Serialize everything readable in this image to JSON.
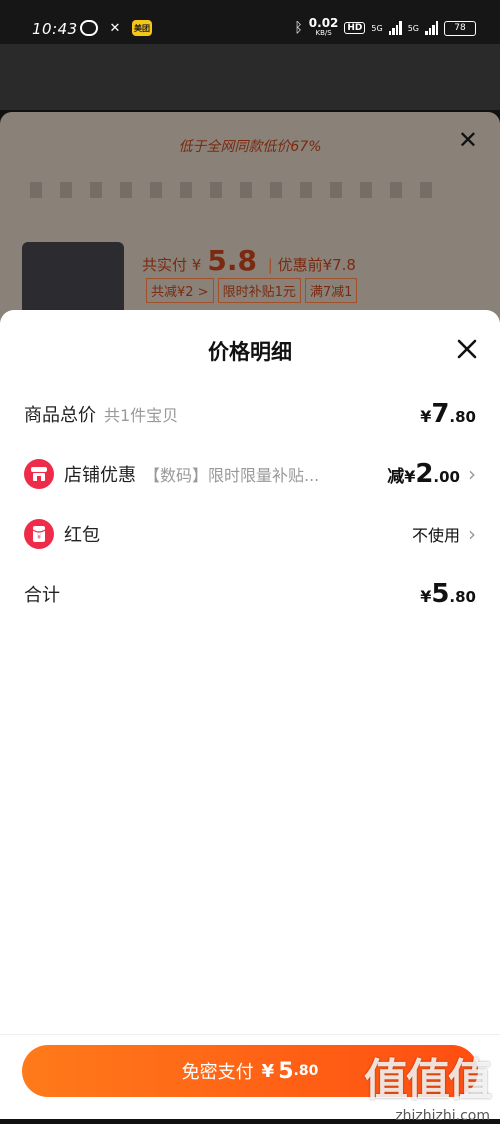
{
  "statusbar": {
    "time": "10:43",
    "speed": "0.02",
    "speed_unit": "KB/S",
    "hd": "HD",
    "net1": "5G",
    "net2": "5G",
    "battery": "78",
    "meituan": "美团"
  },
  "background": {
    "banner": "低于全网同款低价67%",
    "total_label": "共实付",
    "total_yen": "¥",
    "total": "5.8",
    "original": "优惠前¥7.8",
    "tags": [
      "共减¥2 >",
      "限时补贴1元",
      "满7减1"
    ]
  },
  "sheet": {
    "title": "价格明细",
    "rows": {
      "goods_total": {
        "label": "商品总价",
        "sub": "共1件宝贝",
        "yen": "¥",
        "big": "7",
        "cents": ".80"
      },
      "shop_discount": {
        "label": "店铺优惠",
        "sub": "【数码】限时限量补贴...",
        "prefix": "减",
        "yen": "¥",
        "big": "2",
        "cents": ".00"
      },
      "red_packet": {
        "label": "红包",
        "value": "不使用"
      },
      "sum": {
        "label": "合计",
        "yen": "¥",
        "big": "5",
        "cents": ".80"
      }
    }
  },
  "pay_button": {
    "label": "免密支付",
    "yen": "¥",
    "big": "5",
    "cents": ".80"
  },
  "watermark": {
    "logo": "值值值",
    "url": "zhizhizhi.com"
  },
  "colors": {
    "accent": "#f0541e",
    "button_start": "#ff7a1a",
    "button_end": "#ff4e12",
    "icon_red": "#ee2c4a"
  }
}
